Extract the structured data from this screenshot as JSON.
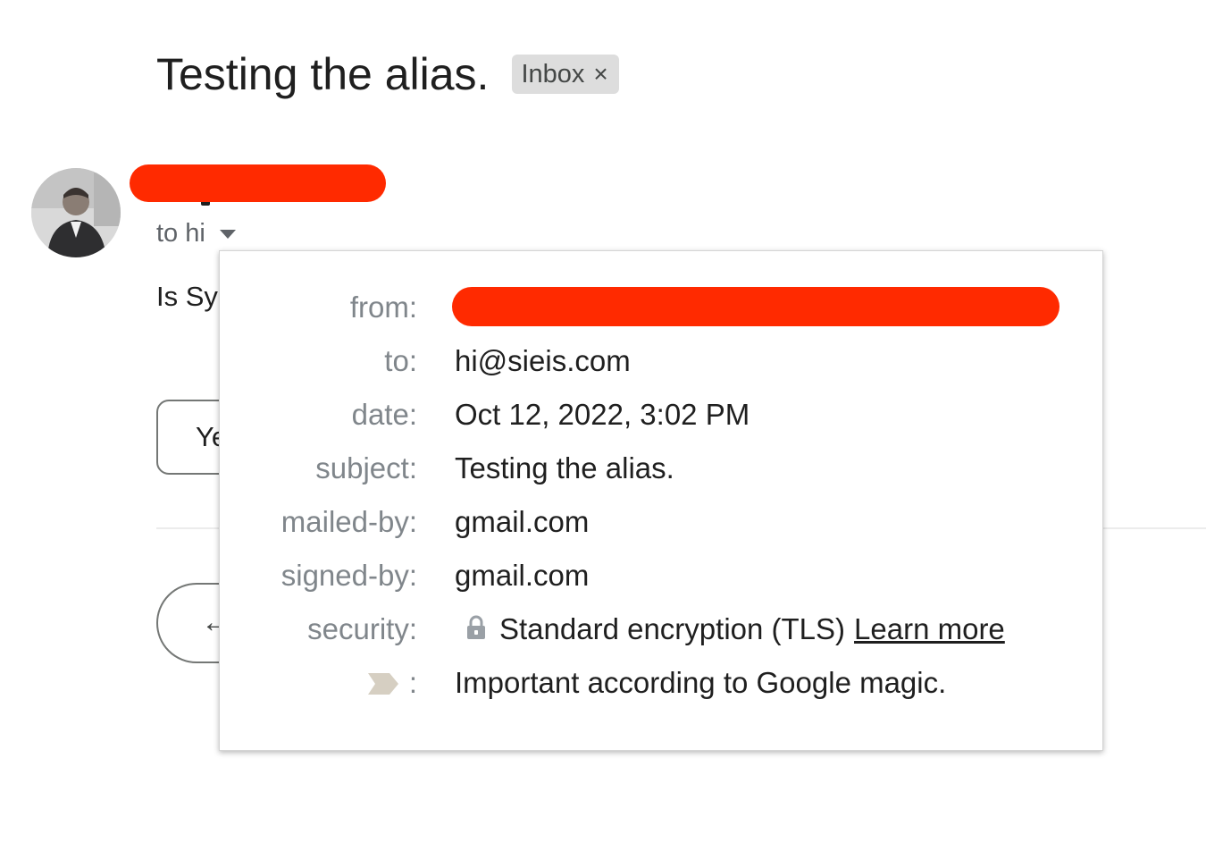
{
  "subject": {
    "title": "Testing the alias.",
    "label_chip": "Inbox",
    "chip_close": "×"
  },
  "message": {
    "to_summary": "to hi",
    "body_preview": "Is Sy",
    "suggested_reply_partial": "Ye"
  },
  "details_popup": {
    "from_label": "from:",
    "to_label": "to:",
    "to_value": "hi@sieis.com",
    "date_label": "date:",
    "date_value": "Oct 12, 2022, 3:02 PM",
    "subject_label": "subject:",
    "subject_value": "Testing the alias.",
    "mailed_by_label": "mailed-by:",
    "mailed_by_value": "gmail.com",
    "signed_by_label": "signed-by:",
    "signed_by_value": "gmail.com",
    "security_label": "security:",
    "security_value": "Standard encryption (TLS)",
    "learn_more": "Learn more",
    "importance_colon": ":",
    "importance_value": "Important according to Google magic."
  },
  "icons": {
    "lock": "lock-icon",
    "importance": "importance-marker-icon",
    "caret": "chevron-down-icon",
    "reply": "reply-arrow-icon"
  },
  "colors": {
    "redaction": "#ff2a00",
    "label_gray": "#80868b",
    "chip_bg": "#dddddd"
  }
}
